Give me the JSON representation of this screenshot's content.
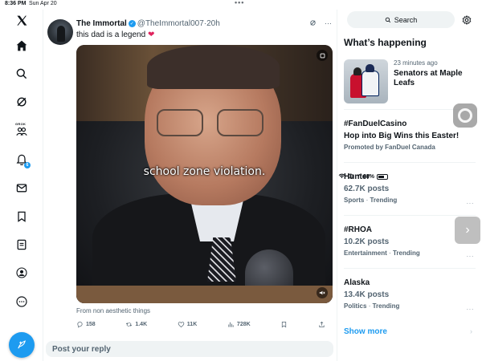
{
  "status": {
    "time": "8:36 PM",
    "date": "Sun Apr 20",
    "battery": "68%",
    "battery_level": 0.68
  },
  "nav": {
    "grok_label": "GROK",
    "notifications_count": "6"
  },
  "tweet": {
    "display_name": "The Immortal",
    "handle": "@TheImmortal007",
    "separator": "·",
    "age": "20h",
    "text": "this dad is a legend",
    "text_emoji": "❤",
    "video_caption": "school zone violation.",
    "from_text": "From non aesthetic things",
    "replies": "158",
    "reposts": "1.4K",
    "likes": "11K",
    "views": "728K"
  },
  "reply": {
    "placeholder": "Post your reply"
  },
  "sidebar": {
    "search_label": "Search",
    "section_title": "What’s happening",
    "news": {
      "meta": "23 minutes ago",
      "title": "Senators at Maple Leafs"
    },
    "trends": [
      {
        "name": "#FanDuelCasino",
        "subtitle": "Hop into Big Wins this Easter!",
        "promo": "Promoted by FanDuel Canada"
      },
      {
        "name": "Hunter",
        "posts": "62.7K posts",
        "category": "Sports",
        "dot": "·",
        "status": "Trending",
        "more": "···"
      },
      {
        "name": "#RHOA",
        "posts": "10.2K posts",
        "category": "Entertainment",
        "dot": "·",
        "status": "Trending",
        "more": "···"
      },
      {
        "name": "Alaska",
        "posts": "13.4K posts",
        "category": "Politics",
        "dot": "·",
        "status": "Trending",
        "more": "···"
      }
    ],
    "show_more": "Show more"
  },
  "colors": {
    "accent": "#1d9bf0",
    "text": "#0f1419",
    "muted": "#536471",
    "heart": "#e0245e"
  }
}
